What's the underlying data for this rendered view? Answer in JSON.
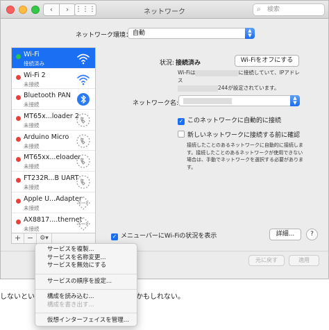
{
  "window": {
    "title": "ネットワーク",
    "search_placeholder": "検索",
    "nav_back": "‹",
    "nav_forward": "›",
    "grid_icon": "⋮⋮⋮"
  },
  "location": {
    "label": "ネットワーク環境：",
    "value": "自動"
  },
  "services": [
    {
      "name": "Wi-Fi",
      "status": "接続済み",
      "dot": "#27c93f",
      "icon": "wifi-icon",
      "selected": true
    },
    {
      "name": "Wi-Fi 2",
      "status": "未接続",
      "dot": "#e9403a",
      "icon": "wifi-icon",
      "selected": false
    },
    {
      "name": "Bluetooth PAN",
      "status": "未接続",
      "dot": "#e9403a",
      "icon": "bluetooth-icon",
      "selected": false
    },
    {
      "name": "MT65x...loader 2",
      "status": "未接続",
      "dot": "#e9403a",
      "icon": "phone-icon",
      "selected": false
    },
    {
      "name": "Arduino Micro",
      "status": "未接続",
      "dot": "#e9403a",
      "icon": "phone-icon",
      "selected": false
    },
    {
      "name": "MT65xx...eloader",
      "status": "未接続",
      "dot": "#e9403a",
      "icon": "phone-icon",
      "selected": false
    },
    {
      "name": "FT232R...B UART",
      "status": "未接続",
      "dot": "#e9403a",
      "icon": "phone-icon",
      "selected": false
    },
    {
      "name": "Apple U...Adapter",
      "status": "未接続",
      "dot": "#e9403a",
      "icon": "ethernet-icon",
      "selected": false
    },
    {
      "name": "AX8817....thernet",
      "status": "未接続",
      "dot": "#e9403a",
      "icon": "ethernet-icon",
      "selected": false
    }
  ],
  "list_buttons": {
    "add": "+",
    "remove": "−",
    "gear": "⚙▾"
  },
  "detail": {
    "status_label": "状況:",
    "status_value": "接続済み",
    "wifi_off_label": "Wi-Fiをオフにする",
    "desc_part1": "Wi-Fiは",
    "desc_part2": "に接続していて、IPアドレス",
    "desc_part3": "244が設定されています。",
    "network_name_label": "ネットワーク名:",
    "auto_join_label": "このネットワークに自動的に接続",
    "ask_join_label": "新しいネットワークに接続する前に確認",
    "ask_join_desc": "接続したことのあるネットワークに自動的に接続します。接続したことのあるネットワークが使用できない場合は、手動でネットワークを選択する必要があります。",
    "menubar_label": "メニューバーにWi-Fiの状況を表示",
    "advanced_label": "詳細...",
    "help_label": "?"
  },
  "footer": {
    "revert_label": "元に戻す",
    "apply_label": "適用"
  },
  "background_text": {
    "left": "しないといけ",
    "right": "かもしれない。"
  },
  "context_menu": {
    "group1": [
      "サービスを複製...",
      "サービスを名称変更...",
      "サービスを無効にする"
    ],
    "group2": [
      "サービスの順序を設定..."
    ],
    "group3": [
      {
        "label": "構成を読み込む...",
        "disabled": false
      },
      {
        "label": "構成を書き出す...",
        "disabled": true
      }
    ],
    "group4": [
      "仮想インターフェイスを管理..."
    ]
  }
}
